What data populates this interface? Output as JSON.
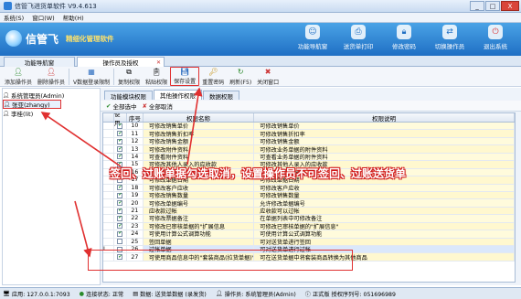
{
  "window": {
    "title": "信管飞进货单软件 V9.4.613",
    "controls": [
      "_",
      "□",
      "X"
    ]
  },
  "menu": [
    "系统(S)",
    "窗口(W)",
    "帮助(H)"
  ],
  "banner": {
    "brand": "信管飞",
    "slogan": "精细化管理软件",
    "nav": [
      {
        "icon": "customer-icon",
        "label": "功能导航窗"
      },
      {
        "icon": "print-icon",
        "label": "送货单打印"
      },
      {
        "icon": "lock-icon",
        "label": "修改密码"
      },
      {
        "icon": "switch-user-icon",
        "label": "切换操作员"
      },
      {
        "icon": "exit-icon",
        "label": "退出系统"
      }
    ]
  },
  "tabs": [
    {
      "label": "功能导航窗",
      "active": false
    },
    {
      "label": "操作员及授权",
      "active": true
    }
  ],
  "toolbar": [
    {
      "icon": "add-user-icon",
      "label": "添加操作员"
    },
    {
      "icon": "delete-user-icon",
      "label": "删除操作员"
    },
    {
      "icon": "data-limit-icon",
      "label": "V数据登录限制"
    },
    {
      "icon": "copy-perm-icon",
      "label": "复制权限"
    },
    {
      "icon": "paste-perm-icon",
      "label": "粘贴权限"
    },
    {
      "icon": "save-icon",
      "label": "保存设置"
    },
    {
      "icon": "reset-password-icon",
      "label": "重置密码"
    },
    {
      "icon": "refresh-icon",
      "label": "刷新(F5)"
    },
    {
      "icon": "close-window-icon",
      "label": "关闭窗口"
    }
  ],
  "tree": [
    {
      "label": "系统管理员(Admin)",
      "selected": false
    },
    {
      "label": "张亚(zhangy)",
      "selected": true
    },
    {
      "label": "李桂(lit)",
      "selected": false
    }
  ],
  "subtabs": [
    {
      "label": "功能模块权限",
      "active": false
    },
    {
      "label": "其他操作权限",
      "active": true
    },
    {
      "label": "数据权限",
      "active": false
    }
  ],
  "actions": {
    "select_all": "全部选中",
    "cancel_all": "全部取消"
  },
  "grid": {
    "headers": [
      "使用",
      "序号",
      "权限名称",
      "权限说明"
    ],
    "rows": [
      {
        "use": true,
        "no": "10",
        "name": "可修改销售单价",
        "desc": "可修改销售单价"
      },
      {
        "use": true,
        "no": "11",
        "name": "可修改销售折扣率",
        "desc": "可修改销售折扣率"
      },
      {
        "use": true,
        "no": "12",
        "name": "可修改销售金额",
        "desc": "可修改销售金额"
      },
      {
        "use": true,
        "no": "13",
        "name": "可修改附件资料",
        "desc": "可修改业务单据的附件资料"
      },
      {
        "use": true,
        "no": "14",
        "name": "可查看附件资料",
        "desc": "可查看业务单据的附件资料"
      },
      {
        "use": true,
        "no": "15",
        "name": "可修改其他人录入的应收款",
        "desc": "可修改其他人录入的应收款"
      },
      {
        "use": true,
        "no": "16",
        "name": "可删除单据记录行",
        "desc": "可删除单据记录行"
      },
      {
        "use": true,
        "no": "17",
        "name": "可修改单据日期",
        "desc": "可修改单据日期"
      },
      {
        "use": true,
        "no": "18",
        "name": "可修改客户应收",
        "desc": "可修改客户应收"
      },
      {
        "use": true,
        "no": "19",
        "name": "可修改销售数量",
        "desc": "可修改销售数量"
      },
      {
        "use": true,
        "no": "20",
        "name": "可修改单据编号",
        "desc": "允许修改单据编号"
      },
      {
        "use": true,
        "no": "21",
        "name": "应收款过帐",
        "desc": "应收款可以过帐"
      },
      {
        "use": true,
        "no": "22",
        "name": "可修改票据备注",
        "desc": "在单据列表中可修改备注"
      },
      {
        "use": true,
        "no": "23",
        "name": "可修改已审核单据的\"扩展信息",
        "desc": "可修改已审核单据的\"扩展信息\""
      },
      {
        "use": true,
        "no": "24",
        "name": "可使用计算公式调算功能",
        "desc": "可使用计算公式调算功能"
      },
      {
        "use": false,
        "no": "25",
        "name": "签回单据",
        "desc": "可对送货单进行签回"
      },
      {
        "use": false,
        "no": "26",
        "name": "过帐单据",
        "desc": "可对送货单进行过帐"
      },
      {
        "use": true,
        "no": "27",
        "name": "可使用商品信息中的\"套装商品(拉货单据)\"功能",
        "desc": "可在送货单据中将套装商品转换为其他商品"
      }
    ]
  },
  "annotation": "签回、过账单据勾选取消，设置操作员不可签回、过账送货单",
  "status": [
    {
      "icon": "computer-icon",
      "text": "应用: 127.0.0.1:7093"
    },
    {
      "icon": "link-icon",
      "text": "连接状态: 正常"
    },
    {
      "icon": "db-icon",
      "text": "数据: 送货单数据 (录发货)"
    },
    {
      "icon": "user-icon",
      "text": "操作员: 系统管理员(Admin)"
    },
    {
      "icon": "info-icon",
      "text": "正式版  授权序列号: 051696989"
    }
  ]
}
